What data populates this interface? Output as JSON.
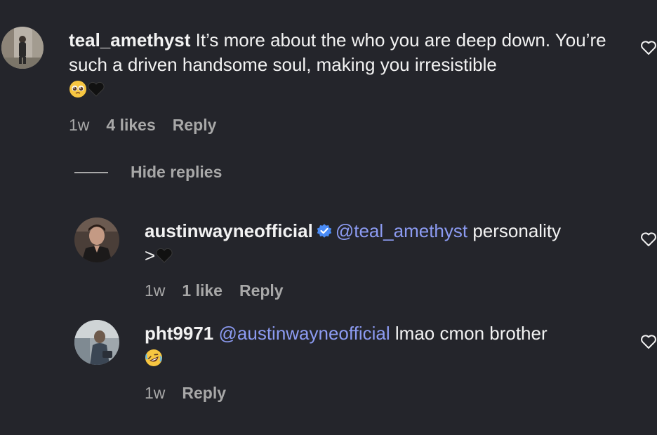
{
  "comments": [
    {
      "username": "teal_amethyst",
      "text": " It’s more about the who you are deep down. You’re such a driven handsome soul, making you irresistible ",
      "emojis": [
        "pleading-face",
        "black-heart"
      ],
      "time": "1w",
      "likes": "4 likes",
      "reply": "Reply"
    }
  ],
  "hide_replies": "Hide replies",
  "replies": [
    {
      "username": "austinwayneofficial",
      "verified": true,
      "mention": "@teal_amethyst",
      "text": " personality",
      "text2": ">",
      "emojis": [
        "black-heart"
      ],
      "time": "1w",
      "likes": "1 like",
      "reply": "Reply"
    },
    {
      "username": "pht9971",
      "mention": "@austinwayneofficial",
      "text": " lmao cmon brother",
      "emojis": [
        "rolling-on-floor-laughing"
      ],
      "time": "1w",
      "reply": "Reply"
    }
  ],
  "colors": {
    "background": "#24252b",
    "text": "#f2f2f2",
    "secondary": "#a8a8a8",
    "mention": "#8c9bf2",
    "verified": "#4a8cf7"
  }
}
